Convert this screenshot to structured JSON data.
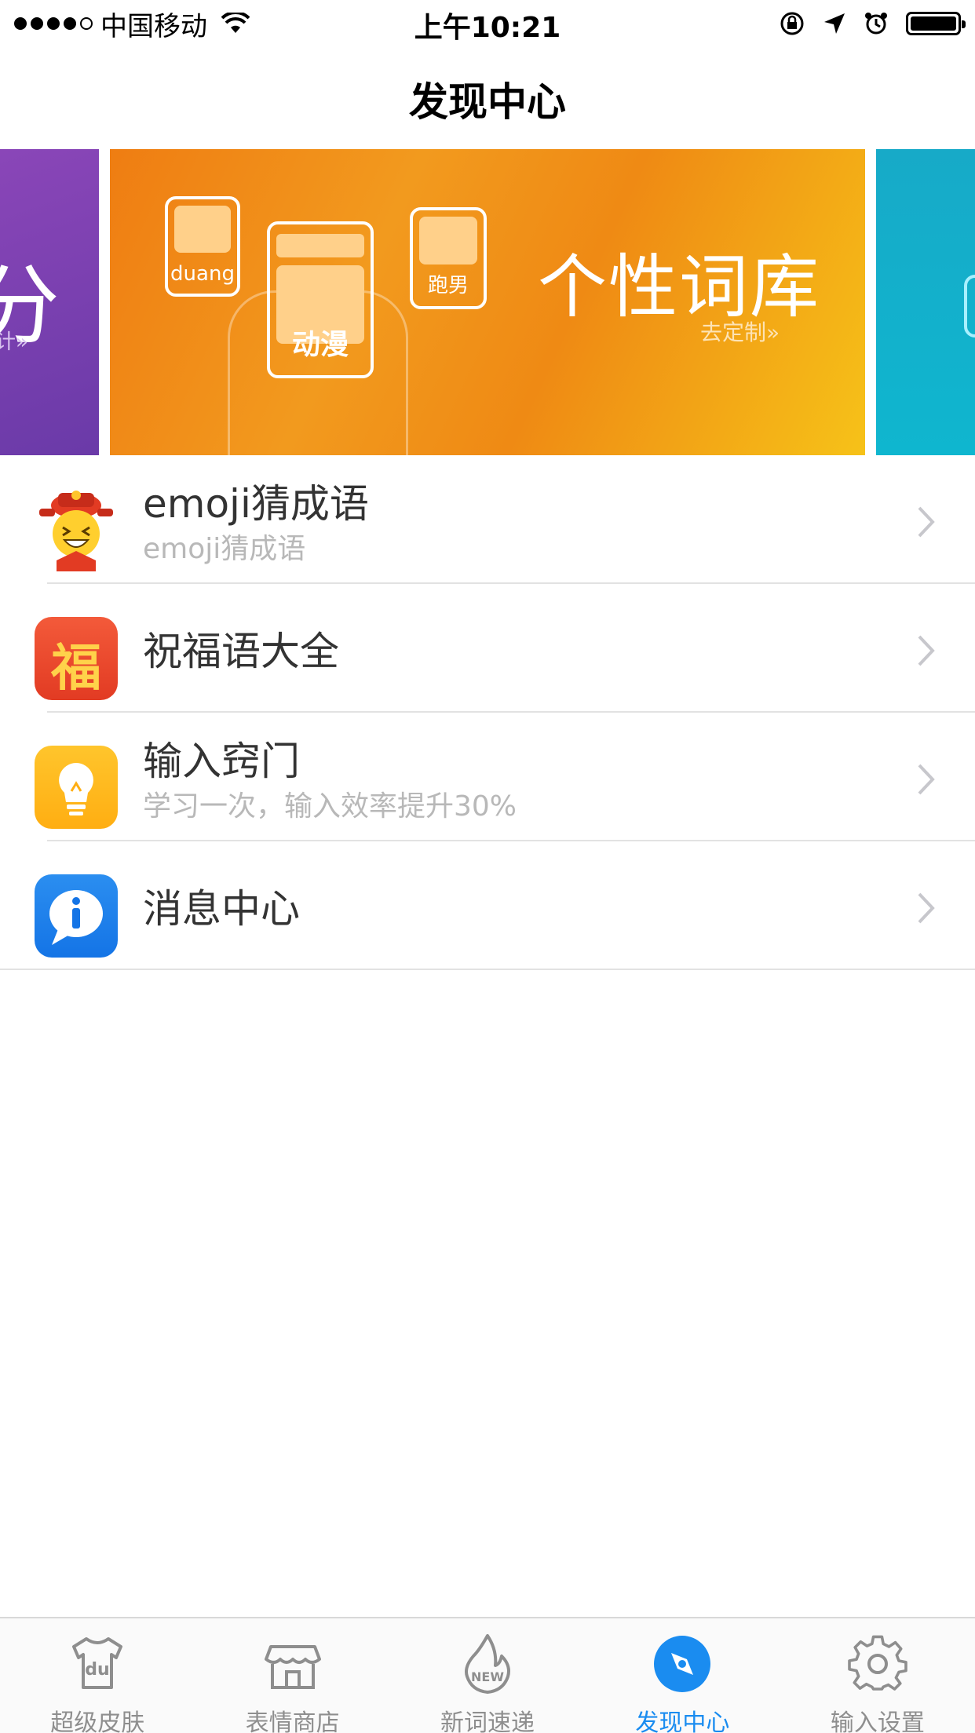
{
  "status_bar": {
    "carrier": "中国移动",
    "time": "上午10:21"
  },
  "nav": {
    "title": "发现中心"
  },
  "banner": {
    "prev_glyph": "分",
    "prev_link": "计»",
    "title": "个性词库",
    "link": "去定制»",
    "stickers": [
      "duang",
      "动漫",
      "跑男"
    ]
  },
  "list": [
    {
      "title": "emoji猜成语",
      "subtitle": "emoji猜成语",
      "icon": "emoji-official-icon"
    },
    {
      "title": "祝福语大全",
      "subtitle": "",
      "icon": "blessing-fu-icon"
    },
    {
      "title": "输入窍门",
      "subtitle": "学习一次，输入效率提升30%",
      "icon": "lightbulb-icon"
    },
    {
      "title": "消息中心",
      "subtitle": "",
      "icon": "info-bubble-icon"
    }
  ],
  "blessing_glyph": "福",
  "tabs": [
    {
      "label": "超级皮肤",
      "icon": "tshirt-du-icon",
      "active": false
    },
    {
      "label": "表情商店",
      "icon": "store-icon",
      "active": false
    },
    {
      "label": "新词速递",
      "icon": "new-flame-icon",
      "active": false
    },
    {
      "label": "发现中心",
      "icon": "compass-icon",
      "active": true
    },
    {
      "label": "输入设置",
      "icon": "gear-icon",
      "active": false
    }
  ],
  "tab_new_text": "NEW",
  "tab_du_text": "du",
  "colors": {
    "active_tab": "#1a8cf0",
    "inactive_tab": "#8e8e8e",
    "banner_orange": "#f29a1e",
    "subtitle_gray": "#b8b8b8"
  }
}
